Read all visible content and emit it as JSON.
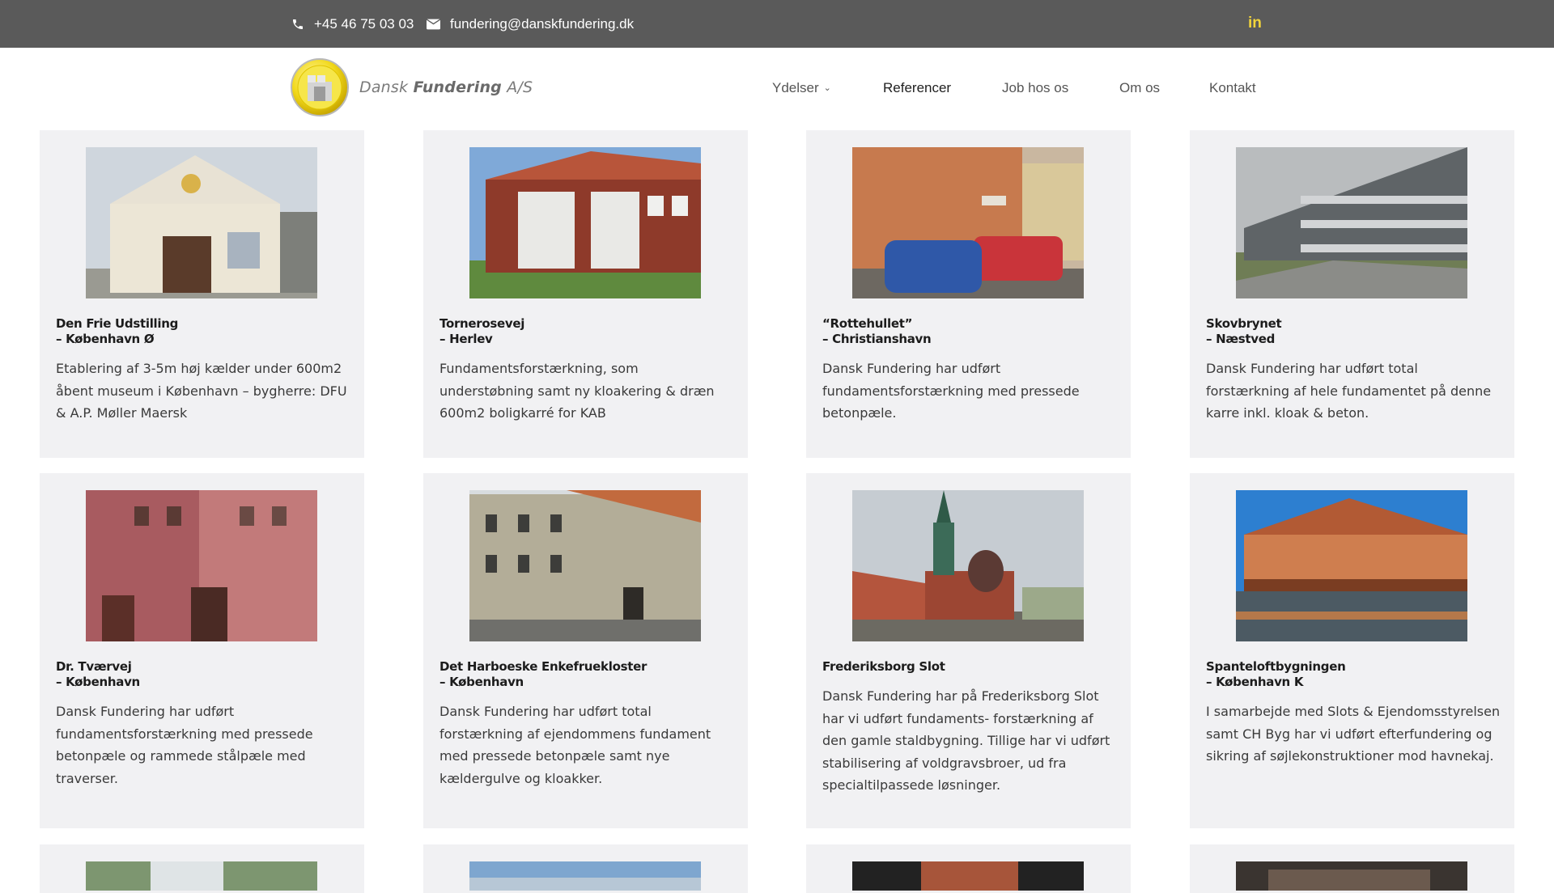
{
  "topbar": {
    "phone": "+45 46 75 03 03",
    "email": "fundering@danskfundering.dk",
    "phone_icon": "phone-icon",
    "email_icon": "envelope-icon",
    "social_icon": "linkedin-icon",
    "social_label": "in",
    "background": "#5a5a5a",
    "accent": "#f1d33b"
  },
  "logo": {
    "name_light": "Dansk",
    "name_bold": "Fundering",
    "name_suffix": "A/S"
  },
  "nav": {
    "items": [
      {
        "label": "Ydelser",
        "has_dropdown": true,
        "active": false
      },
      {
        "label": "Referencer",
        "has_dropdown": false,
        "active": true
      },
      {
        "label": "Job hos os",
        "has_dropdown": false,
        "active": false
      },
      {
        "label": "Om os",
        "has_dropdown": false,
        "active": false
      },
      {
        "label": "Kontakt",
        "has_dropdown": false,
        "active": false
      }
    ]
  },
  "references": [
    {
      "title": "Den Frie Udstilling",
      "location": "– København Ø",
      "description": "Etablering af 3-5m høj kælder under 600m2 åbent museum i København – bygherre: DFU & A.P. Møller Maersk"
    },
    {
      "title": "Tornerosevej",
      "location": "– Herlev",
      "description": "Fundamentsforstærkning, som understøbning samt ny kloakering & dræn 600m2 boligkarré for KAB"
    },
    {
      "title": "“Rottehullet”",
      "location": "– Christianshavn",
      "description": "Dansk Fundering har udført fundamentsforstærkning med pressede betonpæle."
    },
    {
      "title": "Skovbrynet",
      "location": "– Næstved",
      "description": "Dansk Fundering har udført total forstærkning af hele fundamentet på denne karre inkl. kloak & beton."
    },
    {
      "title": "Dr. Tværvej",
      "location": "– København",
      "description": "Dansk Fundering har udført fundamentsforstærkning med pressede betonpæle og rammede stålpæle med traverser."
    },
    {
      "title": "Det Harboeske Enkefruekloster",
      "location": "– København",
      "description": "Dansk Fundering har udført total forstærkning af ejendommens fundament med pressede betonpæle samt nye kældergulve og kloakker."
    },
    {
      "title": "Frederiksborg Slot",
      "location": "",
      "description": "Dansk Fundering har på Frederiksborg Slot har vi udført fundaments- forstærkning af den gamle staldbygning. Tillige har vi udført stabilisering af voldgravsbroer, ud fra specialtilpassede løsninger."
    },
    {
      "title": "Spanteloftbygningen",
      "location": "– København K",
      "description": "I samarbejde med Slots & Ejendomsstyrelsen samt CH Byg har vi udført efterfundering og sikring af søjlekonstruktioner mod havnekaj."
    }
  ]
}
